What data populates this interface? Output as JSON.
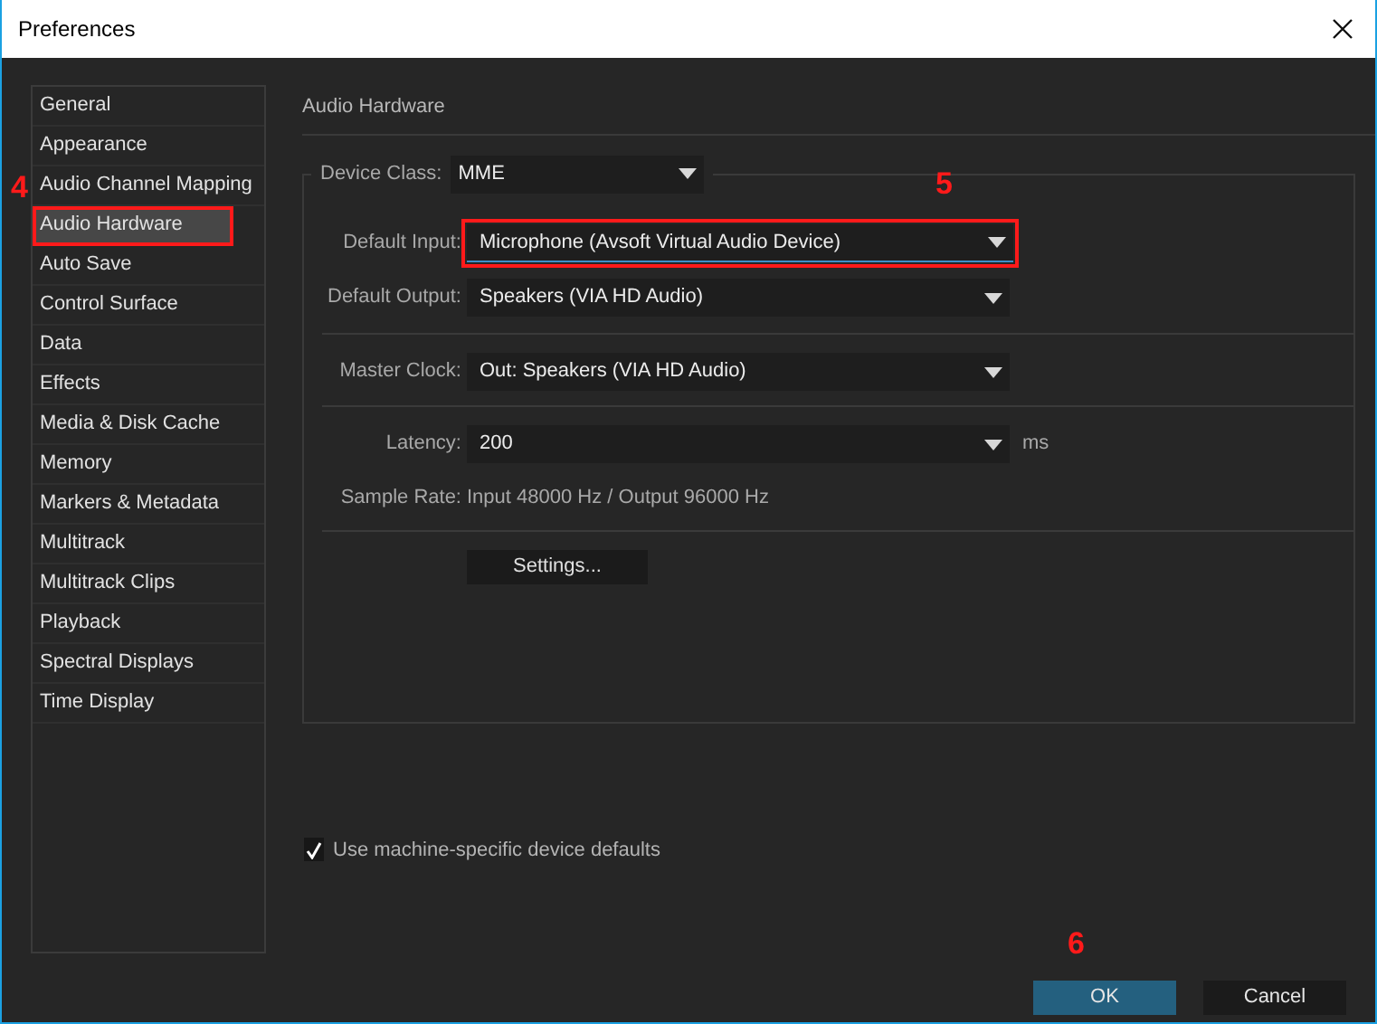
{
  "window": {
    "title": "Preferences"
  },
  "sidebar": {
    "items": [
      {
        "label": "General",
        "selected": false,
        "highlighted": false
      },
      {
        "label": "Appearance",
        "selected": false,
        "highlighted": false
      },
      {
        "label": "Audio Channel Mapping",
        "selected": false,
        "highlighted": false
      },
      {
        "label": "Audio Hardware",
        "selected": true,
        "highlighted": true
      },
      {
        "label": "Auto Save",
        "selected": false,
        "highlighted": false
      },
      {
        "label": "Control Surface",
        "selected": false,
        "highlighted": false
      },
      {
        "label": "Data",
        "selected": false,
        "highlighted": false
      },
      {
        "label": "Effects",
        "selected": false,
        "highlighted": false
      },
      {
        "label": "Media & Disk Cache",
        "selected": false,
        "highlighted": false
      },
      {
        "label": "Memory",
        "selected": false,
        "highlighted": false
      },
      {
        "label": "Markers & Metadata",
        "selected": false,
        "highlighted": false
      },
      {
        "label": "Multitrack",
        "selected": false,
        "highlighted": false
      },
      {
        "label": "Multitrack Clips",
        "selected": false,
        "highlighted": false
      },
      {
        "label": "Playback",
        "selected": false,
        "highlighted": false
      },
      {
        "label": "Spectral Displays",
        "selected": false,
        "highlighted": false
      },
      {
        "label": "Time Display",
        "selected": false,
        "highlighted": false
      }
    ]
  },
  "panel": {
    "title": "Audio Hardware",
    "device_class": {
      "label": "Device Class:",
      "value": "MME"
    },
    "sections": [
      [
        {
          "kind": "dropdown",
          "label": "Default Input:",
          "value": "Microphone (Avsoft Virtual Audio Device)",
          "focused": true,
          "highlighted": true
        },
        {
          "kind": "dropdown",
          "label": "Default Output:",
          "value": "Speakers (VIA HD Audio)",
          "focused": false,
          "highlighted": false
        }
      ],
      [
        {
          "kind": "dropdown",
          "label": "Master Clock:",
          "value": "Out: Speakers (VIA HD Audio)",
          "focused": false,
          "highlighted": false
        }
      ],
      [
        {
          "kind": "dropdown",
          "label": "Latency:",
          "value": "200",
          "unit": "ms",
          "focused": false,
          "highlighted": false
        },
        {
          "kind": "text",
          "label": "Sample Rate:",
          "value": "Input 48000 Hz / Output 96000 Hz"
        }
      ],
      [
        {
          "kind": "button",
          "label": "Settings..."
        }
      ]
    ],
    "checkbox": {
      "label": "Use machine-specific device defaults",
      "checked": true
    }
  },
  "buttons": [
    {
      "label": "OK",
      "kind": "primary"
    },
    {
      "label": "Cancel",
      "kind": "secondary"
    }
  ],
  "annotations": [
    {
      "label": "4"
    },
    {
      "label": "5"
    },
    {
      "label": "6"
    }
  ]
}
